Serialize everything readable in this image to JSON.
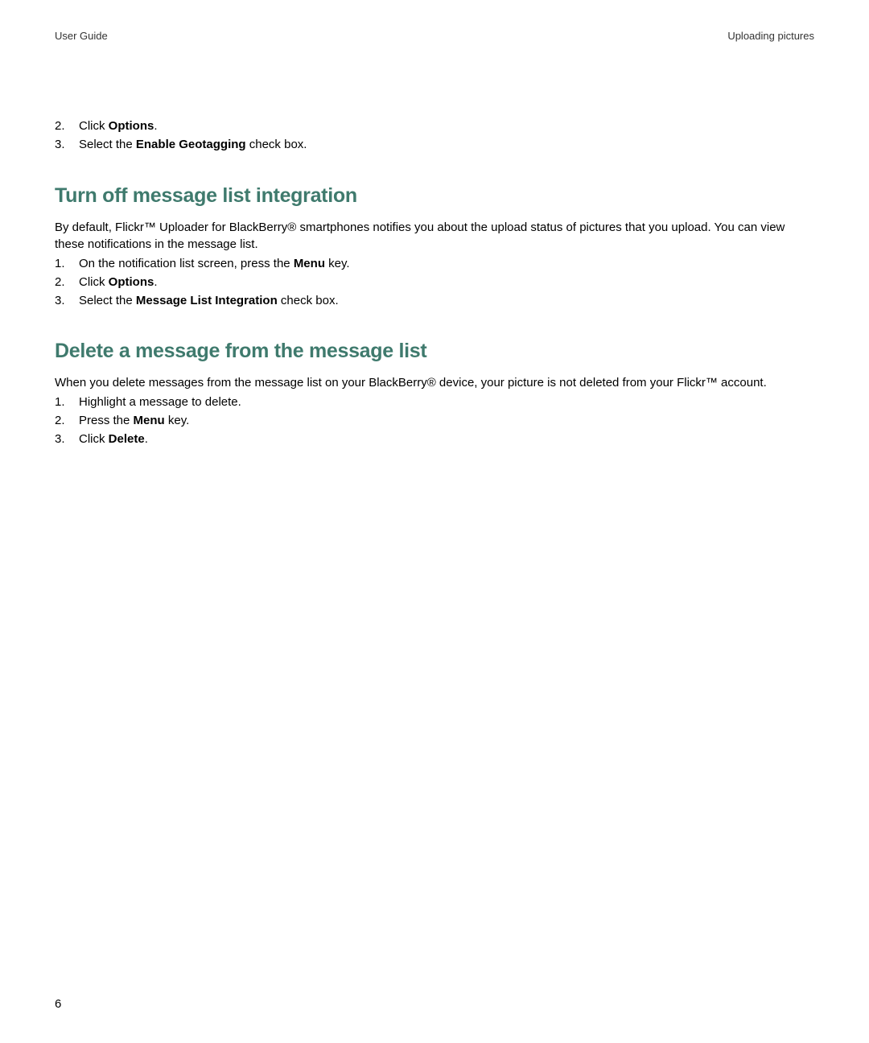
{
  "header": {
    "left": "User Guide",
    "right": "Uploading pictures"
  },
  "intro_list": [
    {
      "n": "2.",
      "pre": "Click ",
      "bold": "Options",
      "post": "."
    },
    {
      "n": "3.",
      "pre": "Select the ",
      "bold": "Enable Geotagging",
      "post": " check box."
    }
  ],
  "section1": {
    "heading": "Turn off message list integration",
    "body": "By default, Flickr™ Uploader for BlackBerry® smartphones notifies you about the upload status of pictures that you upload. You can view these notifications in the message list.",
    "steps": [
      {
        "n": "1.",
        "pre": "On the notification list screen, press the ",
        "bold": "Menu",
        "post": " key."
      },
      {
        "n": "2.",
        "pre": "Click ",
        "bold": "Options",
        "post": "."
      },
      {
        "n": "3.",
        "pre": "Select the ",
        "bold": "Message List Integration",
        "post": " check box."
      }
    ]
  },
  "section2": {
    "heading": "Delete a message from the message list",
    "body": "When you delete messages from the message list on your BlackBerry® device, your picture is not deleted from your Flickr™ account.",
    "steps": [
      {
        "n": "1.",
        "pre": "Highlight a message to delete.",
        "bold": "",
        "post": ""
      },
      {
        "n": "2.",
        "pre": "Press the ",
        "bold": "Menu",
        "post": " key."
      },
      {
        "n": "3.",
        "pre": "Click ",
        "bold": "Delete",
        "post": "."
      }
    ]
  },
  "page_number": "6"
}
